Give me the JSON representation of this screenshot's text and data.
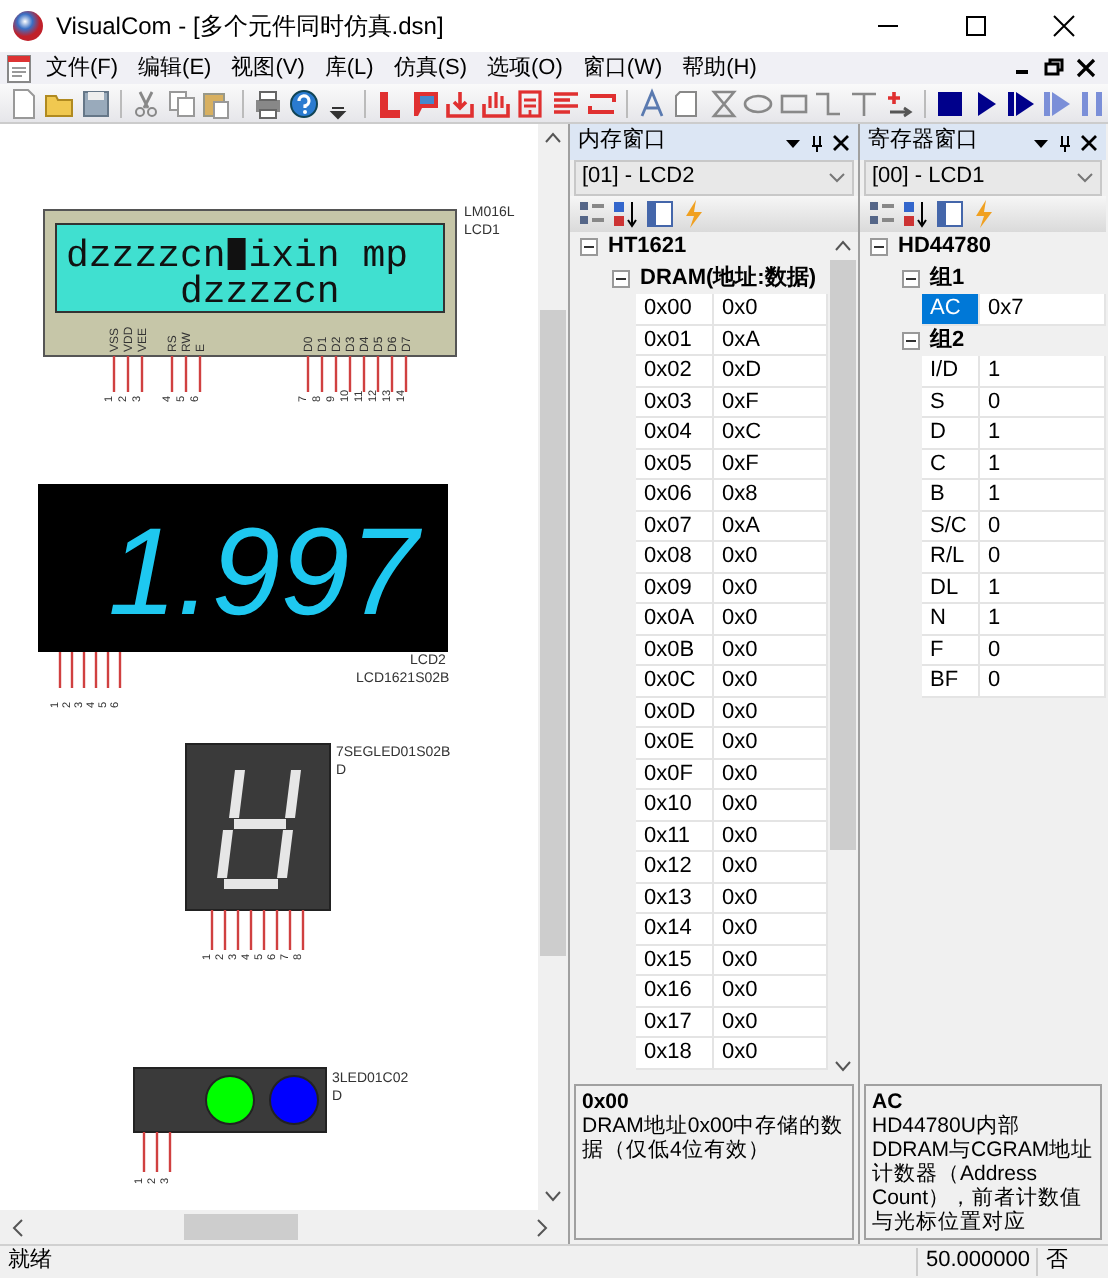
{
  "window": {
    "title": "VisualCom - [多个元件同时仿真.dsn]"
  },
  "menu": [
    "文件(F)",
    "编辑(E)",
    "视图(V)",
    "库(L)",
    "仿真(S)",
    "选项(O)",
    "窗口(W)",
    "帮助(H)"
  ],
  "canvas": {
    "components": [
      {
        "kind": "char_lcd",
        "name": "LM016L",
        "ref": "LCD1",
        "line1_before_cursor": "dzzzzcn",
        "line1_after_cursor": "ixin mp",
        "line2": "dzzzzcn",
        "pin_groups": [
          {
            "names": [
              "VSS",
              "VDD",
              "VEE"
            ],
            "numbers": [
              "1",
              "2",
              "3"
            ]
          },
          {
            "names": [
              "RS",
              "RW",
              "E"
            ],
            "numbers": [
              "4",
              "5",
              "6"
            ]
          },
          {
            "names": [
              "D0",
              "D1",
              "D2",
              "D3",
              "D4",
              "D5",
              "D6",
              "D7"
            ],
            "numbers": [
              "7",
              "8",
              "9",
              "10",
              "11",
              "12",
              "13",
              "14"
            ]
          }
        ]
      },
      {
        "kind": "segment_lcd",
        "name": "LCD1621S02B",
        "ref": "LCD2",
        "display": "1.997",
        "pin_numbers": [
          "1",
          "2",
          "3",
          "4",
          "5",
          "6"
        ]
      },
      {
        "kind": "seven_segment",
        "name": "7SEGLED01S02B",
        "ref": "D",
        "segments": {
          "a": false,
          "b": true,
          "c": true,
          "d": true,
          "e": true,
          "f": true,
          "g": true
        },
        "pin_numbers": [
          "1",
          "2",
          "3",
          "4",
          "5",
          "6",
          "7",
          "8"
        ]
      },
      {
        "kind": "led_bar",
        "name": "3LED01C02",
        "ref": "D",
        "leds": [
          {
            "on": false
          },
          {
            "on": true,
            "color": "#00ff00"
          },
          {
            "on": true,
            "color": "#0000ff"
          }
        ],
        "pin_numbers": [
          "1",
          "2",
          "3"
        ]
      }
    ]
  },
  "memory_panel": {
    "title": "内存窗口",
    "selector": "[01] - LCD2",
    "tree": [
      {
        "name": "HT1621",
        "expanded": true,
        "children": [
          {
            "name": "DRAM(地址:数据)",
            "expanded": true,
            "children": [
              {
                "name": "0x00",
                "value": "0x0",
                "selected": false
              },
              {
                "name": "0x01",
                "value": "0xA",
                "selected": false
              },
              {
                "name": "0x02",
                "value": "0xD",
                "selected": false
              },
              {
                "name": "0x03",
                "value": "0xF",
                "selected": false
              },
              {
                "name": "0x04",
                "value": "0xC",
                "selected": false
              },
              {
                "name": "0x05",
                "value": "0xF",
                "selected": false
              },
              {
                "name": "0x06",
                "value": "0x8",
                "selected": false
              },
              {
                "name": "0x07",
                "value": "0xA",
                "selected": false
              },
              {
                "name": "0x08",
                "value": "0x0",
                "selected": false
              },
              {
                "name": "0x09",
                "value": "0x0",
                "selected": false
              },
              {
                "name": "0x0A",
                "value": "0x0",
                "selected": false
              },
              {
                "name": "0x0B",
                "value": "0x0",
                "selected": false
              },
              {
                "name": "0x0C",
                "value": "0x0",
                "selected": false
              },
              {
                "name": "0x0D",
                "value": "0x0",
                "selected": false
              },
              {
                "name": "0x0E",
                "value": "0x0",
                "selected": false
              },
              {
                "name": "0x0F",
                "value": "0x0",
                "selected": false
              },
              {
                "name": "0x10",
                "value": "0x0",
                "selected": false
              },
              {
                "name": "0x11",
                "value": "0x0",
                "selected": false
              },
              {
                "name": "0x12",
                "value": "0x0",
                "selected": false
              },
              {
                "name": "0x13",
                "value": "0x0",
                "selected": false
              },
              {
                "name": "0x14",
                "value": "0x0",
                "selected": false
              },
              {
                "name": "0x15",
                "value": "0x0",
                "selected": false
              },
              {
                "name": "0x16",
                "value": "0x0",
                "selected": false
              },
              {
                "name": "0x17",
                "value": "0x0",
                "selected": false
              },
              {
                "name": "0x18",
                "value": "0x0",
                "selected": false
              }
            ]
          }
        ]
      }
    ],
    "description": {
      "title": "0x00",
      "text": "DRAM地址0x00中存储的数据（仅低4位有效）"
    }
  },
  "register_panel": {
    "title": "寄存器窗口",
    "selector": "[00] - LCD1",
    "tree": [
      {
        "name": "HD44780",
        "expanded": true,
        "children": [
          {
            "name": "组1",
            "expanded": true,
            "children": [
              {
                "name": "AC",
                "value": "0x7",
                "selected": true
              }
            ]
          },
          {
            "name": "组2",
            "expanded": true,
            "children": [
              {
                "name": "I/D",
                "value": "1",
                "selected": false
              },
              {
                "name": "S",
                "value": "0",
                "selected": false
              },
              {
                "name": "D",
                "value": "1",
                "selected": false
              },
              {
                "name": "C",
                "value": "1",
                "selected": false
              },
              {
                "name": "B",
                "value": "1",
                "selected": false
              },
              {
                "name": "S/C",
                "value": "0",
                "selected": false
              },
              {
                "name": "R/L",
                "value": "0",
                "selected": false
              },
              {
                "name": "DL",
                "value": "1",
                "selected": false
              },
              {
                "name": "N",
                "value": "1",
                "selected": false
              },
              {
                "name": "F",
                "value": "0",
                "selected": false
              },
              {
                "name": "BF",
                "value": "0",
                "selected": false
              }
            ]
          }
        ]
      }
    ],
    "description": {
      "title": "AC",
      "text": "HD44780U内部DDRAM与CGRAM地址计数器（Address Count），前者计数值与光标位置对应"
    }
  },
  "status_bar": {
    "message": "就绪",
    "value": "50.000000",
    "flag": "否"
  }
}
